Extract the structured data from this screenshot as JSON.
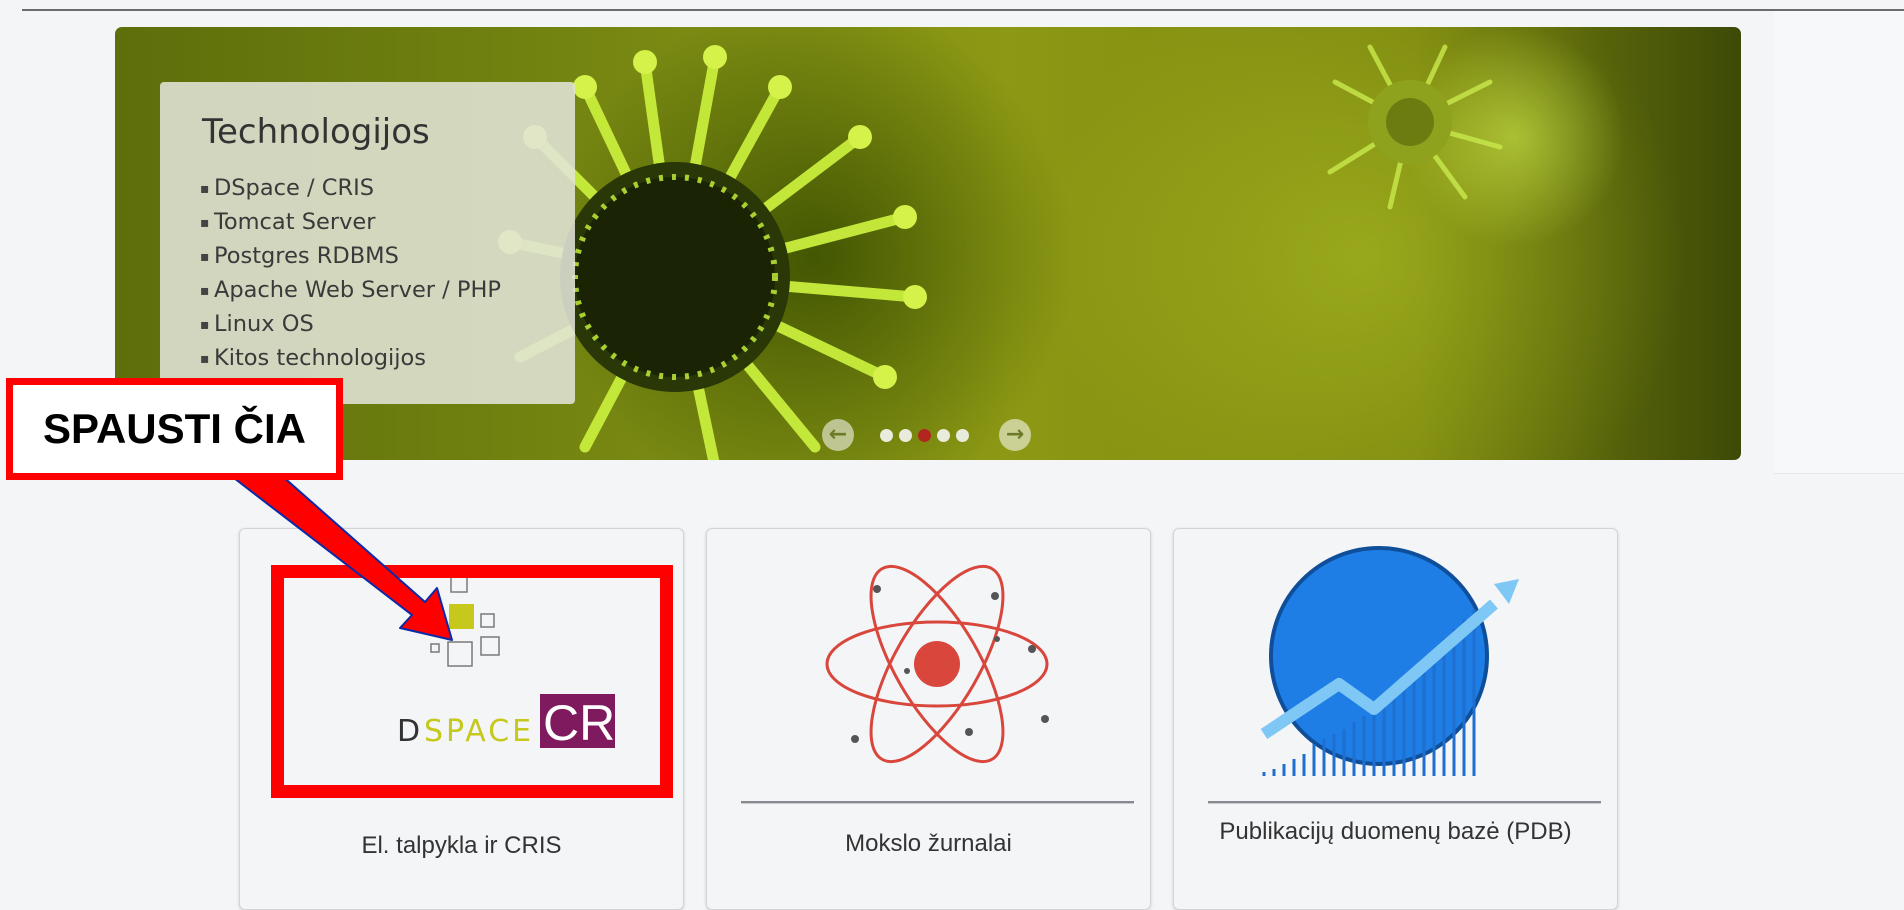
{
  "carousel": {
    "caption_title": "Technologijos",
    "caption_items": [
      "DSpace / CRIS",
      "Tomcat Server",
      "Postgres RDBMS",
      "Apache Web Server / PHP",
      "Linux OS",
      "Kitos technologijos"
    ],
    "prev_icon": "arrow-left-circle-icon",
    "next_icon": "arrow-right-circle-icon",
    "dot_count": 5,
    "active_dot": 3
  },
  "cards": [
    {
      "label": "El. talpykla ir CRIS",
      "icon": "dspace-cris-logo"
    },
    {
      "label": "Mokslo žurnalai",
      "icon": "atom-icon"
    },
    {
      "label": "Publikacijų duomenų bazė (PDB)",
      "icon": "growth-chart-icon"
    }
  ],
  "dspace_logo": {
    "word_left": "D",
    "word_mid": "SPACE",
    "word_right": "CRIS"
  },
  "annotation": {
    "callout_text": "SPAUSTI ČIA"
  },
  "colors": {
    "highlight": "#ff0000",
    "dspace_yellow": "#c6c81c",
    "cris_purple": "#7f1a5e",
    "atom_red": "#d9473c",
    "chart_blue": "#1e7ee6"
  }
}
